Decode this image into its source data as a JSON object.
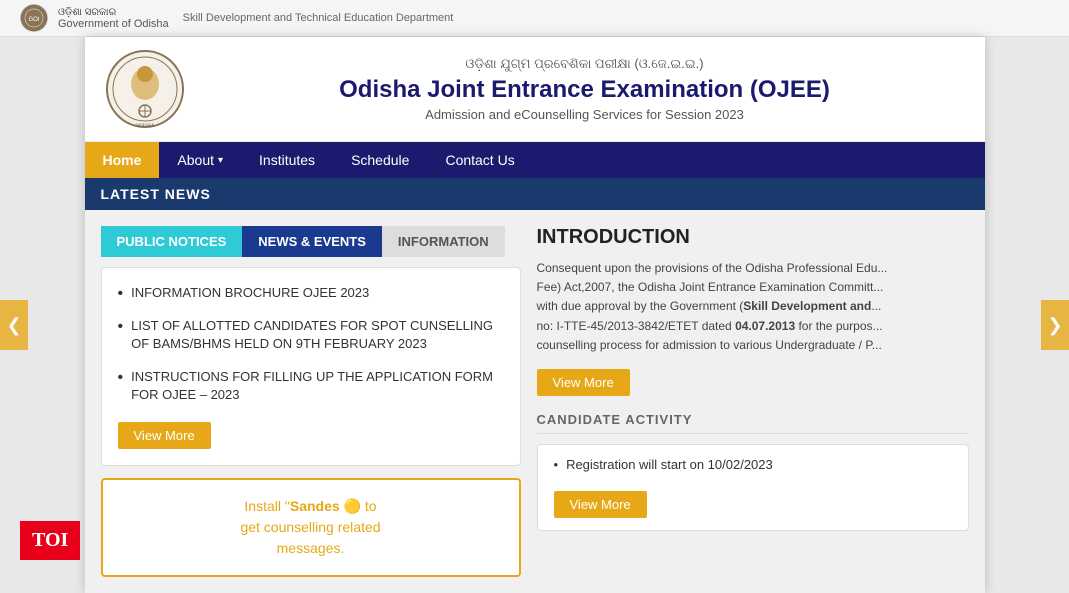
{
  "gov_bar": {
    "logo_text": "GOI",
    "org_line1": "ଓଡ଼ିଶା ସରକାର",
    "org_line2": "Government of Odisha",
    "dept": "Skill Development and Technical Education Department"
  },
  "header": {
    "odia_title": "ଓଡ଼ିଶା ଯୁଗ୍ମ ପ୍ରବେଶିକା ପରୀକ୍ଷା (ଓ.ଜେ.ଇ.ଇ.)",
    "title": "Odisha Joint Entrance Examination (OJEE)",
    "subtitle": "Admission and eCounselling Services for Session 2023"
  },
  "nav": {
    "items": [
      {
        "label": "Home",
        "active": true
      },
      {
        "label": "About",
        "has_arrow": true
      },
      {
        "label": "Institutes"
      },
      {
        "label": "Schedule"
      },
      {
        "label": "Contact Us"
      }
    ]
  },
  "latest_news": {
    "label": "LATEST NEWS"
  },
  "tabs": [
    {
      "label": "PUBLIC NOTICES",
      "style": "cyan"
    },
    {
      "label": "NEWS & EVENTS",
      "style": "blue"
    },
    {
      "label": "INFORMATION",
      "style": "plain"
    }
  ],
  "notices": [
    {
      "text": "INFORMATION BROCHURE OJEE 2023"
    },
    {
      "text": "LIST OF ALLOTTED CANDIDATES FOR SPOT CUNSELLING OF BAMS/BHMS HELD ON 9TH FEBRUARY 2023"
    },
    {
      "text": "INSTRUCTIONS FOR FILLING UP THE APPLICATION FORM FOR OJEE – 2023"
    }
  ],
  "view_more_btn": "View More",
  "sandes": {
    "line1_before": "Install \"",
    "brand": "Sandes",
    "line1_after": "\" 🟡 to",
    "line2": "get counselling related",
    "line3": "messages."
  },
  "introduction": {
    "title": "INTRODUCTION",
    "text1": "Consequent upon the provisions of the Odisha Professional Edu...",
    "text2": "Fee) Act,2007, the Odisha Joint Entrance Examination Committ...",
    "text3": "with due approval by the Government (",
    "bold1": "Skill Development and",
    "text4": "no: I-TTE-45/2013-3842/ETET dated ",
    "bold2": "04.07.2013",
    "text5": " for the purpos...",
    "text6": "counselling process for admission to various Undergraduate / P...",
    "view_more": "View More"
  },
  "candidate_activity": {
    "title": "CANDIDATE ACTIVITY",
    "items": [
      {
        "text": "Registration will start on 10/02/2023"
      }
    ],
    "view_more": "View More"
  },
  "toi": "TOI",
  "arrows": {
    "left": "❮",
    "right": "❯"
  }
}
